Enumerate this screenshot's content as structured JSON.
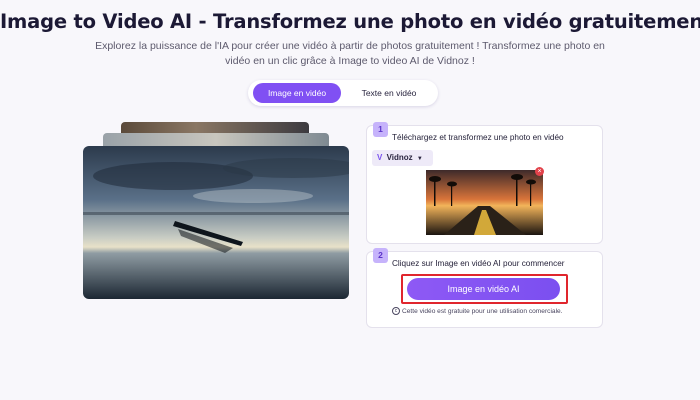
{
  "header": {
    "title": "Image to Video AI - Transformez une photo en vidéo gratuitement",
    "subtitle_line1": "Explorez la puissance de l'IA pour créer une vidéo à partir de photos gratuitement ! Transformez une photo en",
    "subtitle_line2": "vidéo en un clic grâce à Image to video AI de Vidnoz !"
  },
  "tabs": [
    {
      "label": "Image en vidéo",
      "active": true
    },
    {
      "label": "Texte en vidéo",
      "active": false
    }
  ],
  "step1": {
    "number": "1",
    "text": "Téléchargez et transformez une photo en vidéo",
    "select_value": "Vidnoz",
    "close_icon": "×"
  },
  "step2": {
    "number": "2",
    "text": "Cliquez sur Image en vidéo AI pour commencer",
    "button_label": "Image en vidéo AI",
    "note": "Cette vidéo est gratuite pour une utilisation comerciale."
  },
  "colors": {
    "accent": "#8050f3",
    "highlight_border": "#e0262d",
    "background": "#f8f7fb"
  },
  "icons": {
    "brand": "vidnoz-logo-icon",
    "dropdown": "chevron-down-icon",
    "close": "close-icon",
    "note": "copyright-icon"
  }
}
